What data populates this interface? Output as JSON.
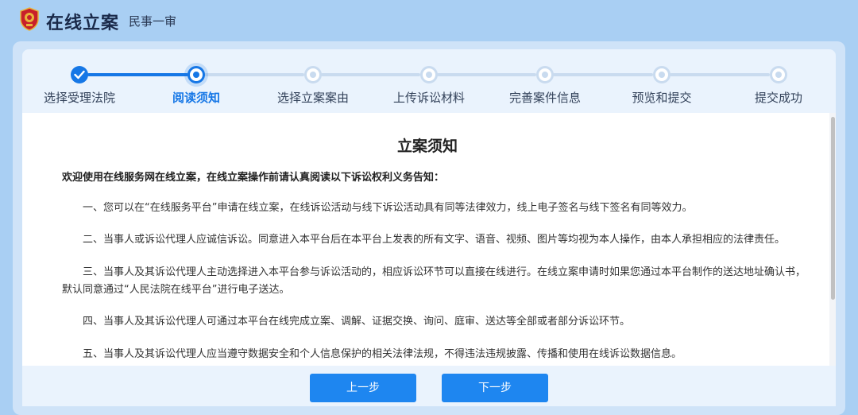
{
  "header": {
    "title": "在线立案",
    "subtitle": "民事一审",
    "logo_icon": "court-emblem-icon"
  },
  "colors": {
    "accent": "#1677e6",
    "button": "#1e86f0",
    "background": "#a9cff3",
    "inactive": "#c9dbef"
  },
  "steps": [
    {
      "label": "选择受理法院",
      "status": "done"
    },
    {
      "label": "阅读须知",
      "status": "current"
    },
    {
      "label": "选择立案案由",
      "status": "todo"
    },
    {
      "label": "上传诉讼材料",
      "status": "todo"
    },
    {
      "label": "完善案件信息",
      "status": "todo"
    },
    {
      "label": "预览和提交",
      "status": "todo"
    },
    {
      "label": "提交成功",
      "status": "todo"
    }
  ],
  "notice": {
    "title": "立案须知",
    "intro": "欢迎使用在线服务网在线立案，在线立案操作前请认真阅读以下诉讼权利义务告知：",
    "items": [
      [
        "一、您可以在“在线服务平台”申请在线立案，在线诉讼活动与线下诉讼活动具有同等法律效力，线上电子签名与线下签名有同等效力。"
      ],
      [
        "二、当事人或诉讼代理人应诚信诉讼。同意进入本平台后在本平台上发表的所有文字、语音、视频、图片等均视为本人操作，由本人承担相应的法律责任。"
      ],
      [
        "三、当事人及其诉讼代理人主动选择进入本平台参与诉讼活动的，相应诉讼环节可以直接在线进行。在线立案申请时如果您通过本平台制作的送达地址确认书，",
        "默认同意通过“人民法院在线平台”进行电子送达。"
      ],
      [
        "四、当事人及其诉讼代理人可通过本平台在线完成立案、调解、证据交换、询问、庭审、送达等全部或者部分诉讼环节。"
      ],
      [
        "五、当事人及其诉讼代理人应当遵守数据安全和个人信息保护的相关法律法规，不得违法违规披露、传播和使用在线诉讼数据信息。"
      ]
    ]
  },
  "buttons": {
    "prev": "上一步",
    "next": "下一步"
  }
}
